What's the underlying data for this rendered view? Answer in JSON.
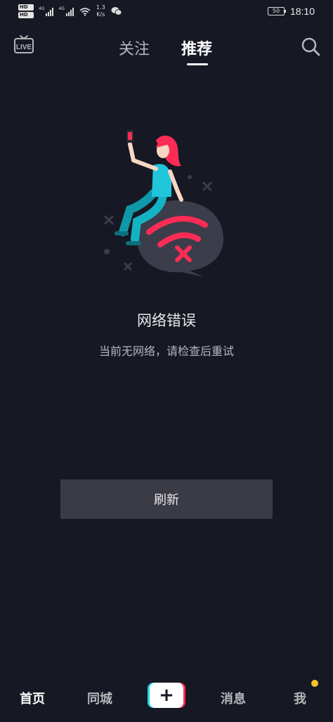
{
  "status_bar": {
    "hd_badge": "HD",
    "network_gen": "4G",
    "net_speed_value": "1.3",
    "net_speed_unit": "K/s",
    "battery": "50",
    "time": "18:10"
  },
  "top_nav": {
    "live_label": "LIVE",
    "tabs": [
      {
        "label": "关注"
      },
      {
        "label": "推荐"
      }
    ]
  },
  "error": {
    "title": "网络错误",
    "description": "当前无网络，请检查后重试",
    "refresh_label": "刷新"
  },
  "bottom_nav": {
    "items": [
      {
        "label": "首页"
      },
      {
        "label": "同城"
      },
      {
        "label": "+"
      },
      {
        "label": "消息"
      },
      {
        "label": "我"
      }
    ]
  },
  "colors": {
    "background": "#161823",
    "accent_red": "#fe2c55",
    "accent_cyan": "#20d5ec",
    "notification_dot": "#f4c32a"
  }
}
